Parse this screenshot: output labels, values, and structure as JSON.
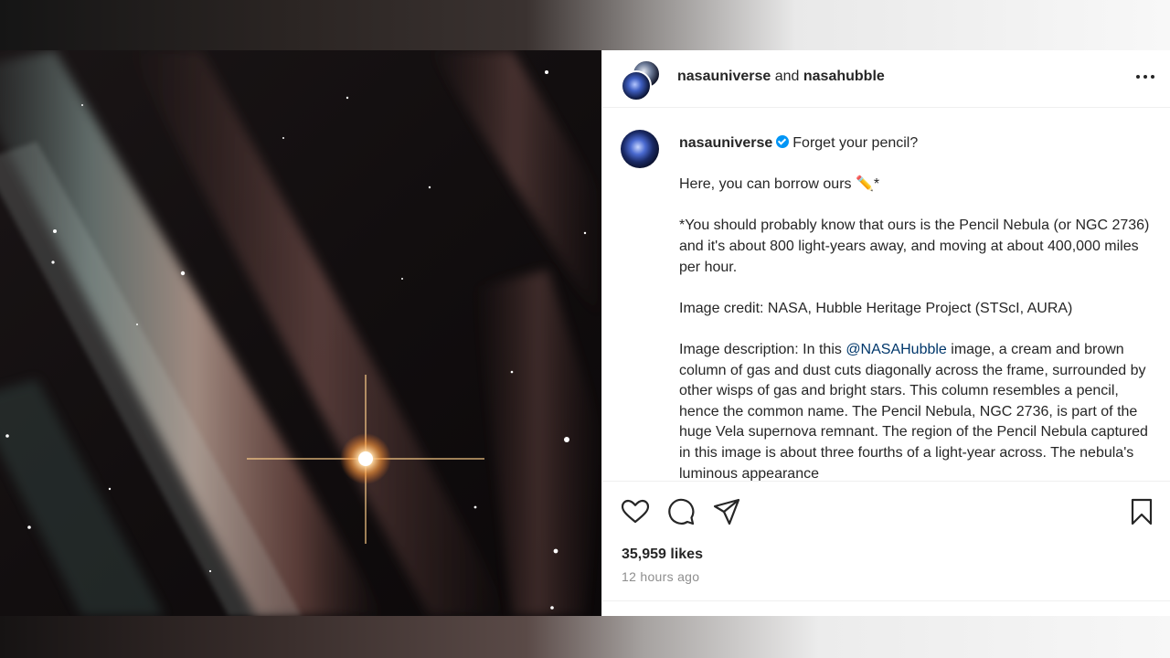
{
  "post": {
    "collab_owner": "nasauniverse",
    "collab_joiner": " and ",
    "collab_partner": "nasahubble",
    "image_alt": "Pencil Nebula, NGC 2736",
    "caption": {
      "username": "nasauniverse",
      "line1": "Forget your pencil?",
      "line2": "Here, you can borrow ours ",
      "pencil_emoji": "✏️",
      "line2_tail": "*",
      "para3": "*You should probably know that ours is the Pencil Nebula (or NGC 2736) and it's about 800 light-years away, and moving at about 400,000 miles per hour.",
      "para4": "Image credit: NASA, Hubble Heritage Project (STScI, AURA)",
      "para5_prefix": "Image description: In this ",
      "para5_mention": "@NASAHubble",
      "para5_rest": " image, a cream and brown column of gas and dust cuts diagonally across the frame, surrounded by other wisps of gas and bright stars. This column resembles a pencil, hence the common name. The Pencil Nebula, NGC 2736, is part of the huge Vela supernova remnant. The region of the Pencil Nebula captured in this image is about three fourths of a light-year across. The nebula's luminous appearance"
    },
    "likes": "35,959 likes",
    "timestamp": "12 hours ago"
  },
  "icons": {
    "more": "more-horizontal-icon",
    "like": "heart-icon",
    "comment": "comment-icon",
    "share": "share-icon",
    "save": "bookmark-icon",
    "verified": "verified-badge-icon"
  },
  "colors": {
    "text": "#262626",
    "muted": "#8e8e8e",
    "mention": "#00376b",
    "verified": "#0095f6"
  }
}
